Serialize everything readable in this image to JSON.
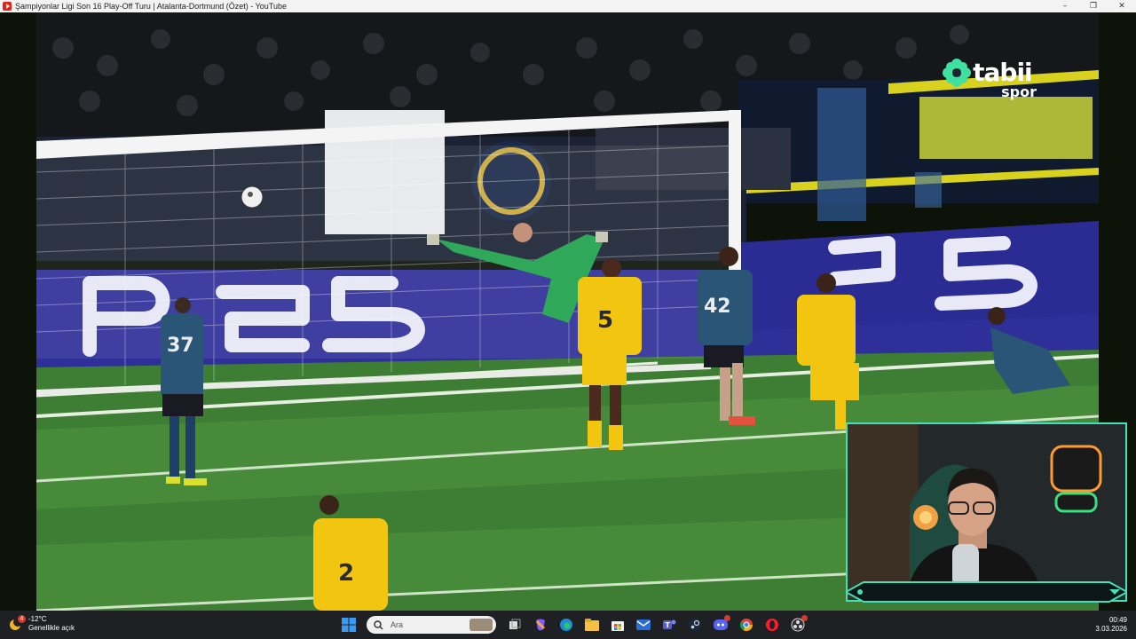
{
  "window": {
    "title": "Şampiyonlar Ligi Son 16 Play-Off Turu | Atalanta-Dortmund (Özet) - YouTube",
    "controls": [
      "minimize-icon",
      "maximize-icon",
      "close-icon"
    ]
  },
  "video": {
    "brand_name": "tabii",
    "brand_sub": "spor",
    "board_text": "PS5",
    "player_numbers": [
      "37",
      "42",
      "5",
      "2"
    ]
  },
  "taskbar": {
    "weather_badge": "4",
    "temperature": "-12°C",
    "weather_status": "Genellikle açık",
    "search_placeholder": "Ara",
    "time": "00:49",
    "date": "3.03.2026",
    "apps": [
      "start-icon",
      "task-view-icon",
      "copilot-icon",
      "edge-icon",
      "file-explorer-icon",
      "microsoft-store-icon",
      "mail-icon",
      "teams-icon",
      "steam-icon",
      "discord-icon",
      "chrome-icon",
      "opera-icon",
      "obs-icon"
    ]
  },
  "colors": {
    "accent_cam": "#40e0b8",
    "pitch": "#3e7d34",
    "ps5_board": "#2f2f9a",
    "home_kit": "#2b5577",
    "away_kit": "#f2c511",
    "keeper_kit": "#2fa85a"
  }
}
